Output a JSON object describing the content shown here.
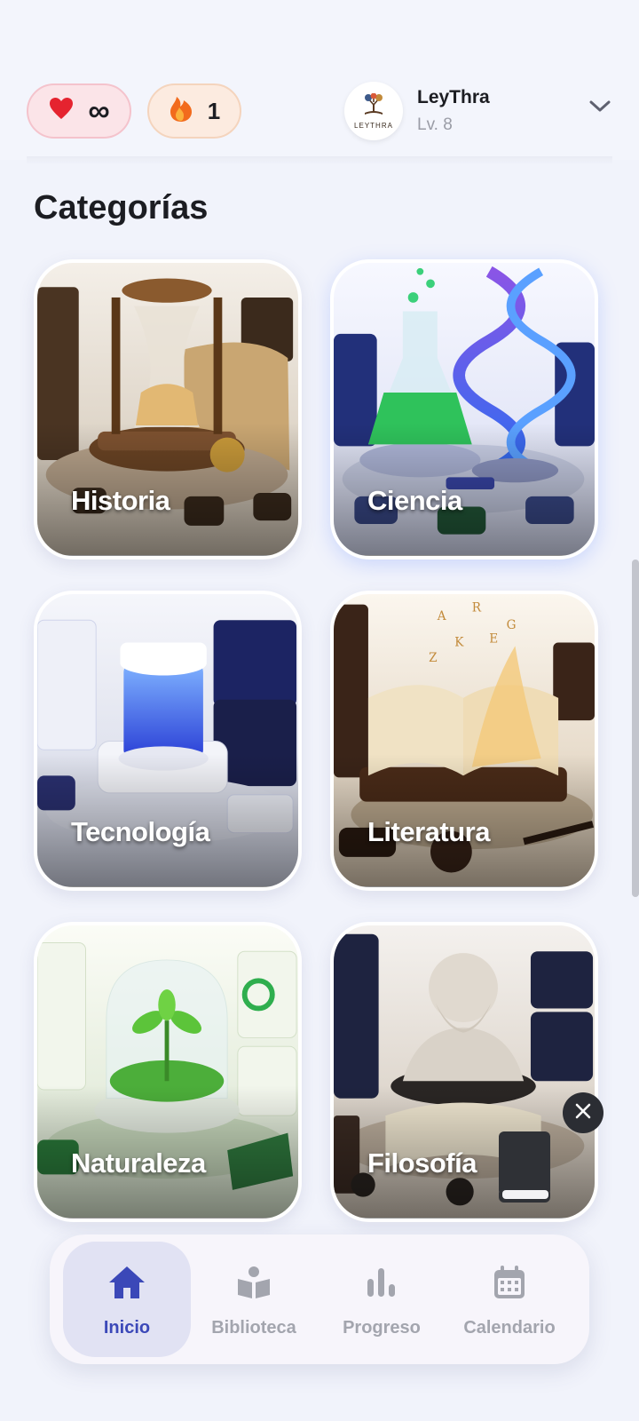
{
  "header": {
    "lives_value": "∞",
    "streak_value": "1",
    "profile": {
      "name": "LeyThra",
      "level": "Lv. 8",
      "logo_text": "LEYTHRA"
    }
  },
  "section_title": "Categorías",
  "categories": [
    {
      "label": "Historia"
    },
    {
      "label": "Ciencia"
    },
    {
      "label": "Tecnología"
    },
    {
      "label": "Literatura"
    },
    {
      "label": "Naturaleza"
    },
    {
      "label": "Filosofía"
    }
  ],
  "bottom_nav": [
    {
      "label": "Inicio",
      "icon": "home-icon",
      "active": true
    },
    {
      "label": "Biblioteca",
      "icon": "reading-icon",
      "active": false
    },
    {
      "label": "Progreso",
      "icon": "bar-chart-icon",
      "active": false
    },
    {
      "label": "Calendario",
      "icon": "calendar-icon",
      "active": false
    }
  ],
  "colors": {
    "accent": "#3b48b8",
    "lives_bg": "#fbe4e8",
    "streak_bg": "#fcebe0",
    "heart": "#e5232f",
    "flame": "#f26b1d"
  }
}
